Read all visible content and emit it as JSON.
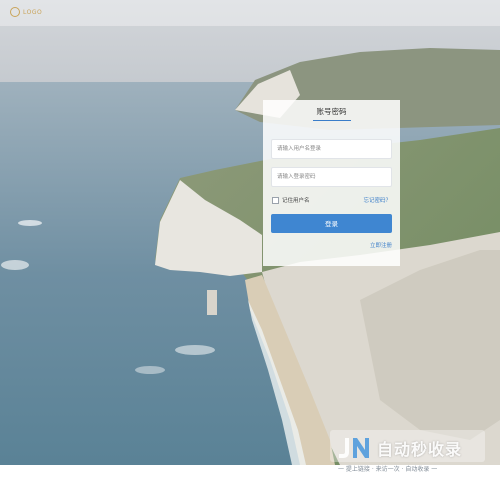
{
  "header": {
    "logo_text": "LOGO"
  },
  "login": {
    "tab_label": "账号密码",
    "username_placeholder": "请输入用户名登录",
    "password_placeholder": "请输入登录密码",
    "remember_label": "记住用户名",
    "forgot_label": "忘记密码？",
    "submit_label": "登录",
    "register_label": "立即注册"
  },
  "watermark": {
    "title": "自动秒收录",
    "subtitle": "一 提上链接 · 来访一次 · 自动收录 一"
  },
  "colors": {
    "accent": "#3f86d1",
    "link": "#3a7dc9",
    "logo": "#c9a45a"
  },
  "icons": {
    "logo": "logo-mark",
    "watermark": "jn-logo"
  }
}
